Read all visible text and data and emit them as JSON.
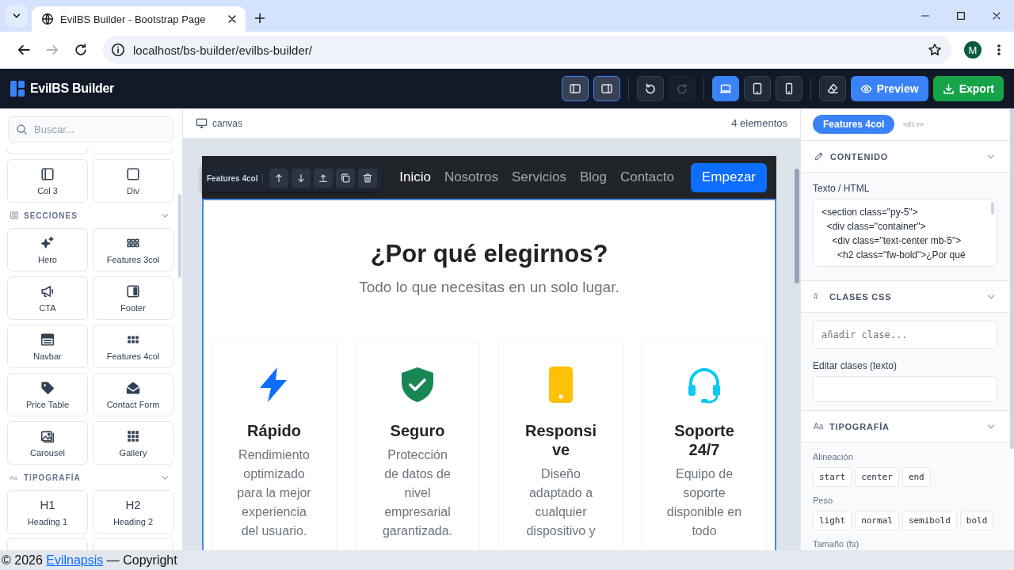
{
  "browser": {
    "tab_title": "EvilBS Builder - Bootstrap Page",
    "url": "localhost/bs-builder/evilbs-builder/",
    "profile_initial": "M"
  },
  "app": {
    "brand": "EvilBS Builder",
    "panels": [
      {
        "kind": "left",
        "on": true
      },
      {
        "kind": "right",
        "on": true
      }
    ],
    "history": [
      {
        "kind": "undo",
        "disabled": false
      },
      {
        "kind": "redo",
        "disabled": true
      }
    ],
    "devices": [
      {
        "kind": "desktop",
        "selected": true
      },
      {
        "kind": "tablet",
        "selected": false
      },
      {
        "kind": "mobile",
        "selected": false
      }
    ],
    "actions": [
      {
        "kind": "preview",
        "label": "Preview"
      },
      {
        "kind": "export",
        "label": "Export"
      }
    ]
  },
  "sidebar": {
    "search": {
      "placeholder": "Buscar..."
    },
    "sections": [
      {
        "items": [
          {
            "kind": "col",
            "label": "Col 3"
          },
          {
            "kind": "div",
            "label": "Div"
          }
        ]
      },
      {
        "title": "SECCIONES",
        "kind": "sections",
        "expanded": true,
        "items": [
          {
            "kind": "hero",
            "label": "Hero"
          },
          {
            "kind": "features3",
            "label": "Features 3col"
          },
          {
            "kind": "cta",
            "label": "CTA"
          },
          {
            "kind": "footer",
            "label": "Footer"
          },
          {
            "kind": "navbar",
            "label": "Navbar"
          },
          {
            "kind": "features4",
            "label": "Features 4col"
          },
          {
            "kind": "price",
            "label": "Price Table"
          },
          {
            "kind": "contact",
            "label": "Contact Form"
          },
          {
            "kind": "carousel",
            "label": "Carousel"
          },
          {
            "kind": "gallery",
            "label": "Gallery"
          }
        ]
      },
      {
        "title": "TIPOGRAFÍA",
        "kind": "typography",
        "glyph": "Aa",
        "expanded": true,
        "items": [
          {
            "kind": "heading",
            "glyph": "H1",
            "label": "Heading 1"
          },
          {
            "kind": "heading",
            "glyph": "H2",
            "label": "Heading 2"
          }
        ]
      }
    ]
  },
  "canvas": {
    "label": "canvas",
    "count": "4 elementos",
    "selection": {
      "label": "Features 4col",
      "actions": [
        {
          "kind": "up"
        },
        {
          "kind": "down"
        },
        {
          "kind": "top"
        },
        {
          "kind": "copy"
        },
        {
          "kind": "delete"
        }
      ]
    },
    "navbar": {
      "links": [
        {
          "label": "Inicio",
          "selected": true
        },
        {
          "label": "Nosotros",
          "selected": false
        },
        {
          "label": "Servicios",
          "selected": false
        },
        {
          "label": "Blog",
          "selected": false
        },
        {
          "label": "Contacto",
          "selected": false
        }
      ],
      "cta": "Empezar"
    },
    "section": {
      "title": "¿Por qué elegirnos?",
      "subtitle": "Todo lo que necesitas en un solo lugar.",
      "features": [
        {
          "kind": "bolt",
          "color": "#0d6efd",
          "title": "Rápido",
          "text": "Rendimiento optimizado para la mejor experiencia del usuario."
        },
        {
          "kind": "shield",
          "color": "#198754",
          "title": "Seguro",
          "text": "Protección de datos de nivel empresarial garantizada."
        },
        {
          "kind": "phone",
          "color": "#ffc107",
          "title": "Responsive",
          "text": "Diseño adaptado a cualquier dispositivo y"
        },
        {
          "kind": "headset",
          "color": "#0dcaf0",
          "title": "Soporte 24/7",
          "text": "Equipo de soporte disponible en todo"
        }
      ]
    }
  },
  "inspector": {
    "badge": "Features 4col",
    "tag": "<div>",
    "sections": [
      {
        "kind": "content",
        "title": "CONTENIDO",
        "expanded": true,
        "field_label": "Texto / HTML",
        "code": "<section class=\"py-5\">\n  <div class=\"container\">\n    <div class=\"text-center mb-5\">\n      <h2 class=\"fw-bold\">¿Por qué"
      },
      {
        "kind": "classes",
        "title": "CLASES CSS",
        "glyph": "#",
        "expanded": true,
        "add_placeholder": "añadir clase...",
        "edit_label": "Editar clases (texto)"
      },
      {
        "kind": "typography",
        "title": "TIPOGRAFÍA",
        "glyph": "Aa",
        "expanded": true,
        "groups": [
          {
            "label": "Alineación",
            "options": [
              "start",
              "center",
              "end"
            ]
          },
          {
            "label": "Peso",
            "options": [
              "light",
              "normal",
              "semibold",
              "bold"
            ]
          },
          {
            "label": "Tamaño (fs)"
          }
        ]
      }
    ]
  },
  "footer": {
    "before": "© 2026",
    "link": "Evilnapsis",
    "after": "— Copyright"
  }
}
